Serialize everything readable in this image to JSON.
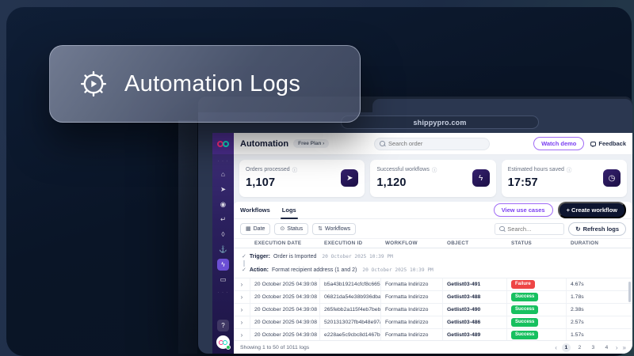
{
  "badge": {
    "label": "Automation Logs"
  },
  "browser": {
    "url": "shippypro.com"
  },
  "icons": {
    "check": "✓",
    "info": "ⓘ",
    "refresh": "↻",
    "help": "?",
    "pager_prev": "‹",
    "pager_next": "›",
    "pager_last": "»",
    "sidebar_dots": "· · ·"
  },
  "app": {
    "header": {
      "title": "Automation",
      "plan_badge": "Free Plan ›",
      "search_placeholder": "Search order",
      "watch_demo": "Watch demo",
      "feedback": "Feedback"
    },
    "sidebar": {
      "icons": [
        {
          "name": "home-icon",
          "glyph": "⌂"
        },
        {
          "name": "send-icon",
          "glyph": "➤"
        },
        {
          "name": "location-pin-icon",
          "glyph": "◉"
        },
        {
          "name": "return-arrow-icon",
          "glyph": "↵"
        },
        {
          "name": "droplet-icon",
          "glyph": "◊"
        },
        {
          "name": "ship-icon",
          "glyph": "⚓"
        },
        {
          "name": "automation-bolt-icon",
          "glyph": "ϟ",
          "state": "active"
        },
        {
          "name": "chat-icon",
          "glyph": "▭"
        }
      ]
    },
    "stats": [
      {
        "label": "Orders processed",
        "value": "1,107",
        "icon": "send-icon",
        "glyph": "➤"
      },
      {
        "label": "Successful workflows",
        "value": "1,120",
        "icon": "bolt-icon",
        "glyph": "ϟ"
      },
      {
        "label": "Estimated hours saved",
        "value": "17:57",
        "icon": "clock-icon",
        "glyph": "◷"
      }
    ],
    "tabs": [
      {
        "label": "Workflows"
      },
      {
        "label": "Logs",
        "state": "active"
      }
    ],
    "actions": {
      "view_use_cases": "View use cases",
      "create_workflow": "+ Create workflow"
    },
    "filters": [
      {
        "label": "Date",
        "icon": "calendar-icon",
        "glyph": "▦"
      },
      {
        "label": "Status",
        "icon": "status-circle-icon",
        "glyph": "⊙"
      },
      {
        "label": "Workflows",
        "icon": "sliders-icon",
        "glyph": "⇅"
      }
    ],
    "logs_search_placeholder": "Search...",
    "refresh_label": "Refresh logs",
    "table": {
      "columns": [
        {
          "label": "EXECUTION DATE"
        },
        {
          "label": "EXECUTION ID"
        },
        {
          "label": "WORKFLOW"
        },
        {
          "label": "OBJECT"
        },
        {
          "label": "STATUS"
        },
        {
          "label": "DURATION"
        }
      ],
      "expanded": {
        "trigger_label": "Trigger:",
        "trigger_text": "Order is Imported",
        "trigger_time": "20 October 2025 10:39 PM",
        "action_label": "Action:",
        "action_text": "Format recipient address (1 and 2)",
        "action_time": "20 October 2025 10:39 PM"
      },
      "rows": [
        {
          "date": "20 October 2025 04:39:08",
          "id": "b5a43b19214cfcf8c6657...",
          "workflow": "Formatta Indirizzo",
          "object": "Getlist03-491",
          "status": "Failure",
          "duration": "4.67s"
        },
        {
          "date": "20 October 2025 04:39:08",
          "id": "06821da54e38b936dba1...",
          "workflow": "Formatta Indirizzo",
          "object": "Getlist03-488",
          "status": "Success",
          "duration": "1.78s"
        },
        {
          "date": "20 October 2025 04:39:08",
          "id": "265febb2a115f4eb7beb5...",
          "workflow": "Formatta Indirizzo",
          "object": "Getlist03-490",
          "status": "Success",
          "duration": "2.38s"
        },
        {
          "date": "20 October 2025 04:39:08",
          "id": "5201313027fb4b48e97a...",
          "workflow": "Formatta Indirizzo",
          "object": "Getlist03-486",
          "status": "Success",
          "duration": "2.57s"
        },
        {
          "date": "20 October 2025 04:39:08",
          "id": "e228ae5c9cbc8d1467be...",
          "workflow": "Formatta Indirizzo",
          "object": "Getlist03-489",
          "status": "Success",
          "duration": "1.57s"
        }
      ]
    },
    "footer": {
      "summary": "Showing 1 to 50 of 1011 logs",
      "pages": [
        {
          "n": "1",
          "state": "active"
        },
        {
          "n": "2"
        },
        {
          "n": "3"
        },
        {
          "n": "4"
        }
      ]
    }
  },
  "colors": {
    "accent_purple": "#7b3ff2",
    "dark_navy": "#0d1530",
    "sidebar_purple": "#3a2a6e",
    "logo_pink": "#ff2e7e",
    "logo_teal": "#0ce0c8",
    "success": "#17c05f",
    "failure": "#ee4545"
  }
}
